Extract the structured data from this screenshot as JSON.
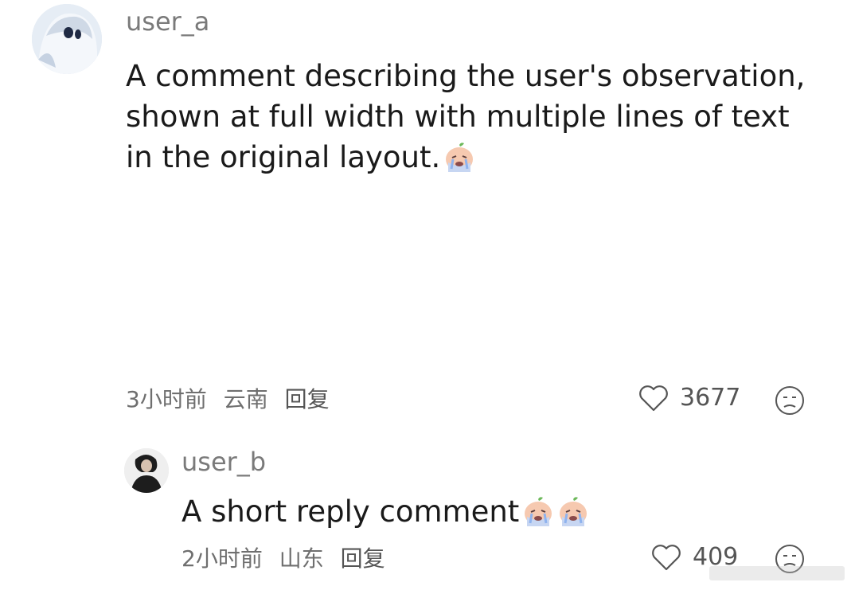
{
  "comments": [
    {
      "username": "user_a",
      "body": "A comment describing the user's observation, shown at full width with multiple lines of text in the original layout.",
      "time": "3小时前",
      "location": "云南",
      "reply_label": "回复",
      "likes": "3677",
      "avatar_icon": "anime-girl-avatar-icon",
      "sticker_icon": "crying-peach-sticker-icon"
    },
    {
      "username": "user_b",
      "body": "A short reply comment",
      "time": "2小时前",
      "location": "山东",
      "reply_label": "回复",
      "likes": "409",
      "avatar_icon": "person-photo-avatar-icon",
      "sticker_icon": "crying-peach-sticker-icon"
    }
  ],
  "colors": {
    "meta": "#6f6f6f",
    "username": "#7a7a7a",
    "text": "#1a1a1a"
  }
}
